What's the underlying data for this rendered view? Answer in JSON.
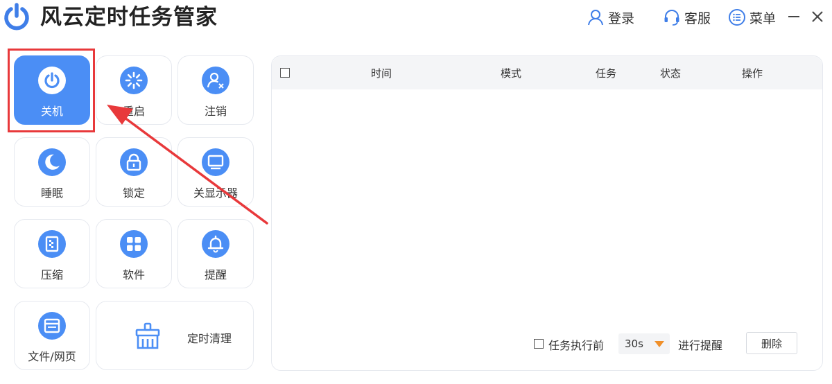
{
  "app": {
    "title": "风云定时任务管家"
  },
  "header": {
    "login_label": "登录",
    "service_label": "客服",
    "menu_label": "菜单"
  },
  "tiles": [
    {
      "key": "shutdown",
      "label": "关机",
      "icon": "power-icon",
      "active": true
    },
    {
      "key": "restart",
      "label": "重启",
      "icon": "restart-icon"
    },
    {
      "key": "logout",
      "label": "注销",
      "icon": "user-x-icon"
    },
    {
      "key": "sleep",
      "label": "睡眠",
      "icon": "moon-icon"
    },
    {
      "key": "lock",
      "label": "锁定",
      "icon": "lock-icon"
    },
    {
      "key": "monitor-off",
      "label": "关显示器",
      "icon": "monitor-icon"
    },
    {
      "key": "compress",
      "label": "压缩",
      "icon": "archive-icon"
    },
    {
      "key": "software",
      "label": "软件",
      "icon": "apps-grid-icon"
    },
    {
      "key": "reminder",
      "label": "提醒",
      "icon": "bell-icon"
    },
    {
      "key": "file-web",
      "label": "文件/网页",
      "icon": "browser-window-icon"
    },
    {
      "key": "cleanup",
      "label": "定时清理",
      "icon": "broom-basket-icon"
    }
  ],
  "table": {
    "columns": [
      "时间",
      "模式",
      "任务",
      "状态",
      "操作"
    ],
    "rows": []
  },
  "footer": {
    "reminder_prefix": "任务执行前",
    "reminder_value": "30s",
    "reminder_suffix": "进行提醒",
    "delete_label": "删除"
  },
  "colors": {
    "accent": "#4b8ef5",
    "highlight": "#e8393b",
    "caret": "#f0902a"
  }
}
